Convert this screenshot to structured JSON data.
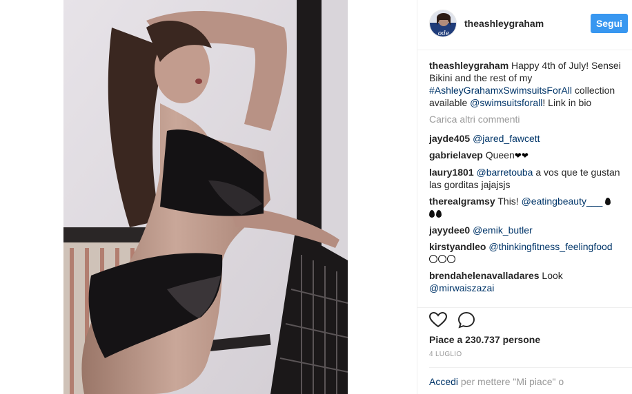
{
  "post": {
    "username": "theashleygraham",
    "follow_label": "Segui",
    "caption_user": "theashleygraham",
    "caption_before": " Happy 4th of July! Sensei Bikini and the rest of my ",
    "caption_hashtag": "#AshleyGrahamxSwimsuitsForAll",
    "caption_middle": " collection available ",
    "caption_mention": "@swimsuitsforall",
    "caption_after": "! Link in bio"
  },
  "load_more": "Carica altri commenti",
  "comments": [
    {
      "user": "jayde405",
      "text": " ",
      "mention": "@jared_fawcett"
    },
    {
      "user": "gabrielavep",
      "text": " Queen",
      "emoji": "heart-emoji"
    },
    {
      "user": "laury1801",
      "text": " a vos que te gustan las gorditas jajajsjs",
      "mention": "@barretouba"
    },
    {
      "user": "therealgramsy",
      "text": " This! ",
      "mention": "@eatingbeauty___",
      "emoji": "fire-emoji"
    },
    {
      "user": "jayydee0",
      "text": " ",
      "mention": "@emik_butler"
    },
    {
      "user": "kirstyandleo",
      "text": " ",
      "mention": "@thinkingfitness_feelingfood",
      "emoji": "smile-emoji"
    },
    {
      "user": "brendahelenavalladares",
      "text": " Look ",
      "mention": "@mirwaiszazai"
    }
  ],
  "actions": {
    "like_icon": "heart-icon",
    "comment_icon": "comment-icon",
    "likes_text": "Piace a 230.737 persone",
    "date_text": "4 LUGLIO"
  },
  "login": {
    "link_text": "Accedi",
    "rest_text": " per mettere \"Mi piace\" o"
  },
  "colors": {
    "follow_button": "#3897f0",
    "link": "#003569",
    "muted": "#999999",
    "text": "#262626"
  }
}
